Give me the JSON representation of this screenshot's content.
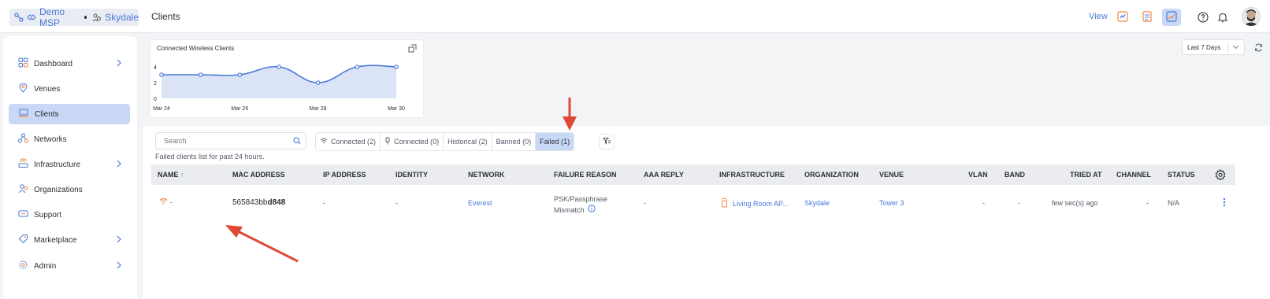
{
  "header": {
    "breadcrumb": {
      "msp": "Demo MSP",
      "org": "Skydale"
    },
    "title": "Clients",
    "view_label": "View"
  },
  "sidebar": {
    "items": [
      {
        "label": "Dashboard",
        "icon": "grid-icon",
        "has_chevron": true
      },
      {
        "label": "Venues",
        "icon": "location-pin-icon",
        "has_chevron": false
      },
      {
        "label": "Clients",
        "icon": "laptop-icon",
        "has_chevron": false,
        "active": true
      },
      {
        "label": "Networks",
        "icon": "network-icon",
        "has_chevron": false
      },
      {
        "label": "Infrastructure",
        "icon": "router-icon",
        "has_chevron": true
      },
      {
        "label": "Organizations",
        "icon": "users-icon",
        "has_chevron": false
      },
      {
        "label": "Support",
        "icon": "ticket-icon",
        "has_chevron": false
      },
      {
        "label": "Marketplace",
        "icon": "tag-icon",
        "has_chevron": true
      },
      {
        "label": "Admin",
        "icon": "gear-icon",
        "has_chevron": true
      }
    ]
  },
  "chart": {
    "title": "Connected Wireless Clients",
    "chart_data": {
      "type": "area",
      "title": "Connected Wireless Clients",
      "x": [
        "Mar 24",
        "Mar 25",
        "Mar 26",
        "Mar 27",
        "Mar 28",
        "Mar 29",
        "Mar 30"
      ],
      "x_tick_labels": [
        "Mar 24",
        "Mar 26",
        "Mar 28",
        "Mar 30"
      ],
      "y_ticks": [
        "0",
        "2",
        "4"
      ],
      "series": [
        {
          "values": [
            3,
            3,
            3,
            4,
            2,
            4,
            4
          ]
        }
      ],
      "ylim": [
        0,
        4
      ],
      "color": "#4a78d8",
      "fill": "#dbe4f6",
      "grid": false
    }
  },
  "controls": {
    "range": "Last 7 Days"
  },
  "search": {
    "placeholder": "Search"
  },
  "tabs": [
    {
      "label": "Connected (2)",
      "icon": "wifi-icon"
    },
    {
      "label": "Connected (0)",
      "icon": "plug-icon"
    },
    {
      "label": "Historical (2)",
      "icon": ""
    },
    {
      "label": "Banned (0)",
      "icon": ""
    },
    {
      "label": "Failed (1)",
      "icon": "",
      "active": true
    }
  ],
  "hint": "Failed clients list for past 24 hours.",
  "table": {
    "columns": [
      "NAME",
      "MAC ADDRESS",
      "IP ADDRESS",
      "IDENTITY",
      "NETWORK",
      "FAILURE REASON",
      "AAA REPLY",
      "INFRASTRUCTURE",
      "ORGANIZATION",
      "VENUE",
      "VLAN",
      "BAND",
      "TRIED AT",
      "CHANNEL",
      "STATUS"
    ],
    "sort_indicator": "↑",
    "rows": [
      {
        "name": "-",
        "mac_prefix": "565843bb",
        "mac_suffix": "d848",
        "ip": "-",
        "identity": "-",
        "network": "Everest",
        "failure_reason_line1": "PSK/Passphrase",
        "failure_reason_line2": "Mismatch",
        "aaa_reply": "-",
        "infrastructure": "Living Room AP...",
        "organization": "Skydale",
        "venue": "Tower 3",
        "vlan": "-",
        "band": "-",
        "tried_at": "few sec(s) ago",
        "channel": "-",
        "status": "N/A"
      }
    ]
  },
  "colors": {
    "accent": "#4a78d8",
    "active_bg": "#c9d8f6",
    "annotation_arrow": "#e04a35",
    "wifi_orange": "#f0883a"
  }
}
